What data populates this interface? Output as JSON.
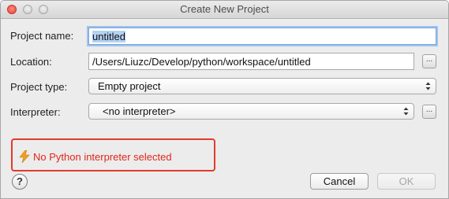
{
  "window": {
    "title": "Create New Project"
  },
  "form": {
    "project_name": {
      "label": "Project name:",
      "value": "untitled"
    },
    "location": {
      "label": "Location:",
      "value": "/Users/Liuzc/Develop/python/workspace/untitled",
      "browse_label": "..."
    },
    "project_type": {
      "label": "Project type:",
      "selected": "Empty project"
    },
    "interpreter": {
      "label": "Interpreter:",
      "selected": "<no interpreter>",
      "browse_label": "..."
    }
  },
  "error": {
    "message": "No Python interpreter selected",
    "icon": "lightning-bolt-icon",
    "color": "#e0271a"
  },
  "footer": {
    "help_label": "?",
    "cancel_label": "Cancel",
    "ok_label": "OK"
  }
}
